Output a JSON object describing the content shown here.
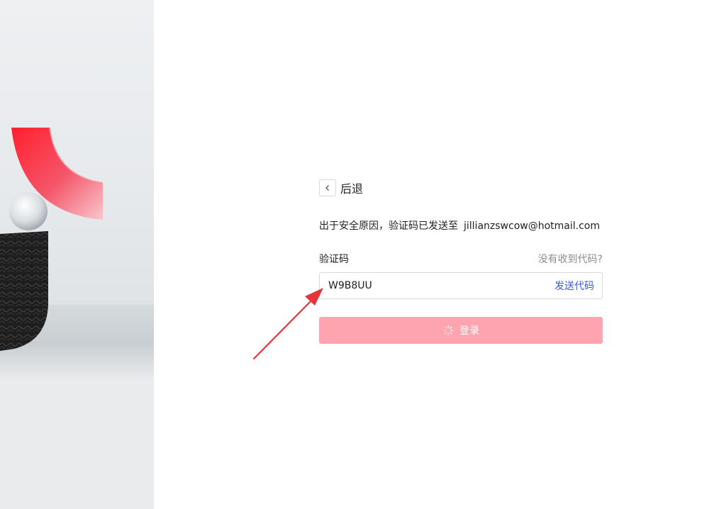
{
  "hero": {
    "image": "abstract-sculpture-illustration"
  },
  "back": {
    "icon": "chevron-left-icon",
    "label": "后退"
  },
  "notice": {
    "text": "出于安全原因，验证码已发送至",
    "email": "jillianzswcow@hotmail.com"
  },
  "code_field": {
    "label": "验证码",
    "help_link": "没有收到代码?",
    "value": "W9B8UU",
    "send_label": "发送代码"
  },
  "login": {
    "label": "登录",
    "state": "loading",
    "icon": "spinner-icon"
  },
  "annotation": {
    "icon": "red-arrow-icon",
    "color": "#e8333a"
  },
  "colors": {
    "primary_disabled": "#fda4b0",
    "link": "#3a5bd6",
    "muted": "#8c8c8c",
    "border": "#d9d9d9"
  }
}
